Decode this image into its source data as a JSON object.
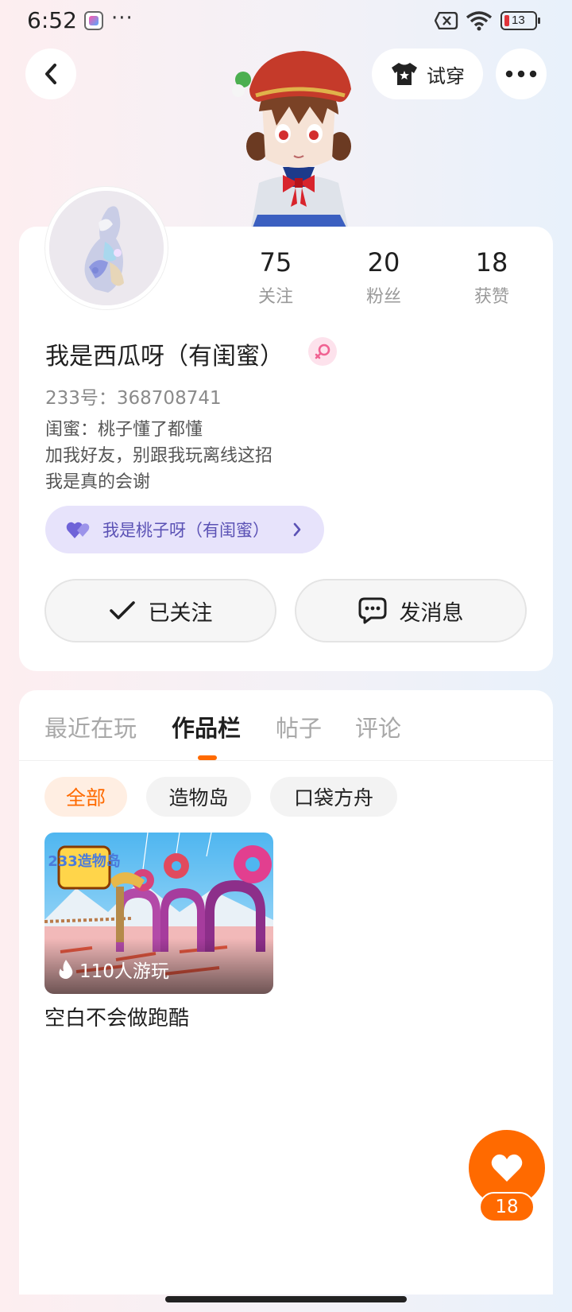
{
  "status_bar": {
    "time": "6:52",
    "dots": "···",
    "battery": "13"
  },
  "header": {
    "try_on_label": "试穿"
  },
  "profile": {
    "stats": [
      {
        "value": "75",
        "label": "关注"
      },
      {
        "value": "20",
        "label": "粉丝"
      },
      {
        "value": "18",
        "label": "获赞"
      }
    ],
    "username": "我是西瓜呀（有闺蜜）",
    "user_id": "233号：368708741",
    "bio_lines": [
      "闺蜜：桃子懂了都懂",
      "加我好友，别跟我玩离线这招",
      "我是真的会谢"
    ],
    "friend_chip_label": "我是桃子呀（有闺蜜）",
    "follow_label": "已关注",
    "message_label": "发消息"
  },
  "tabs": [
    {
      "label": "最近在玩",
      "active": false
    },
    {
      "label": "作品栏",
      "active": true
    },
    {
      "label": "帖子",
      "active": false
    },
    {
      "label": "评论",
      "active": false
    }
  ],
  "filters": [
    {
      "label": "全部",
      "active": true
    },
    {
      "label": "造物岛",
      "active": false
    },
    {
      "label": "口袋方舟",
      "active": false
    }
  ],
  "works": [
    {
      "logo_text": "233造物岛",
      "play_count": "110人游玩",
      "title": "空白不会做跑酷"
    }
  ],
  "like_fab": {
    "count": "18"
  },
  "colors": {
    "accent": "#ff6a00",
    "friend_chip_bg": "#e7e3fb",
    "friend_chip_text": "#5b52b5"
  }
}
